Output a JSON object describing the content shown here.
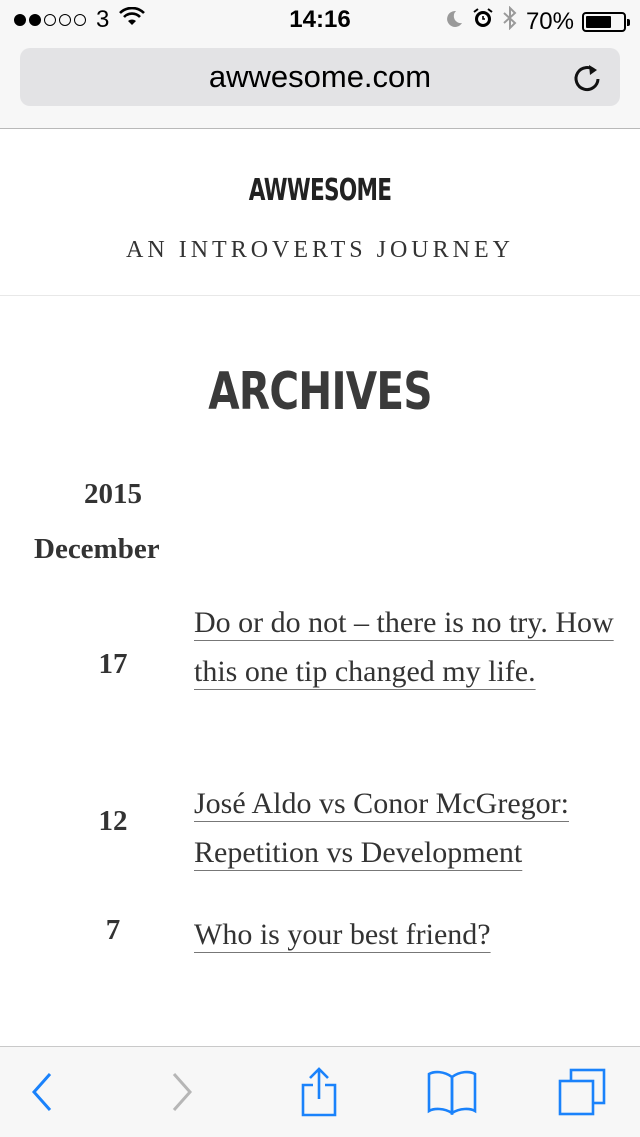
{
  "status_bar": {
    "carrier": "3",
    "time": "14:16",
    "battery": "70%",
    "battery_level": 0.7
  },
  "browser": {
    "url": "awwesome.com"
  },
  "site": {
    "logo": "AWWESOME",
    "tagline": "AN INTROVERTS JOURNEY"
  },
  "archives": {
    "title": "ARCHIVES",
    "year": "2015",
    "month": "December",
    "entries": [
      {
        "day": "17",
        "title": "Do or do not – there is no try. How this one tip changed my life."
      },
      {
        "day": "12",
        "title": "José Aldo vs Conor McGregor: Repetition vs Development"
      },
      {
        "day": "7",
        "title": "Who is your best friend?"
      }
    ]
  },
  "toolbar": {
    "icons": [
      "back-icon",
      "forward-icon",
      "share-icon",
      "bookmarks-icon",
      "tabs-icon"
    ],
    "accent": "#1a82fb",
    "disabled": "#b6b6b6"
  }
}
